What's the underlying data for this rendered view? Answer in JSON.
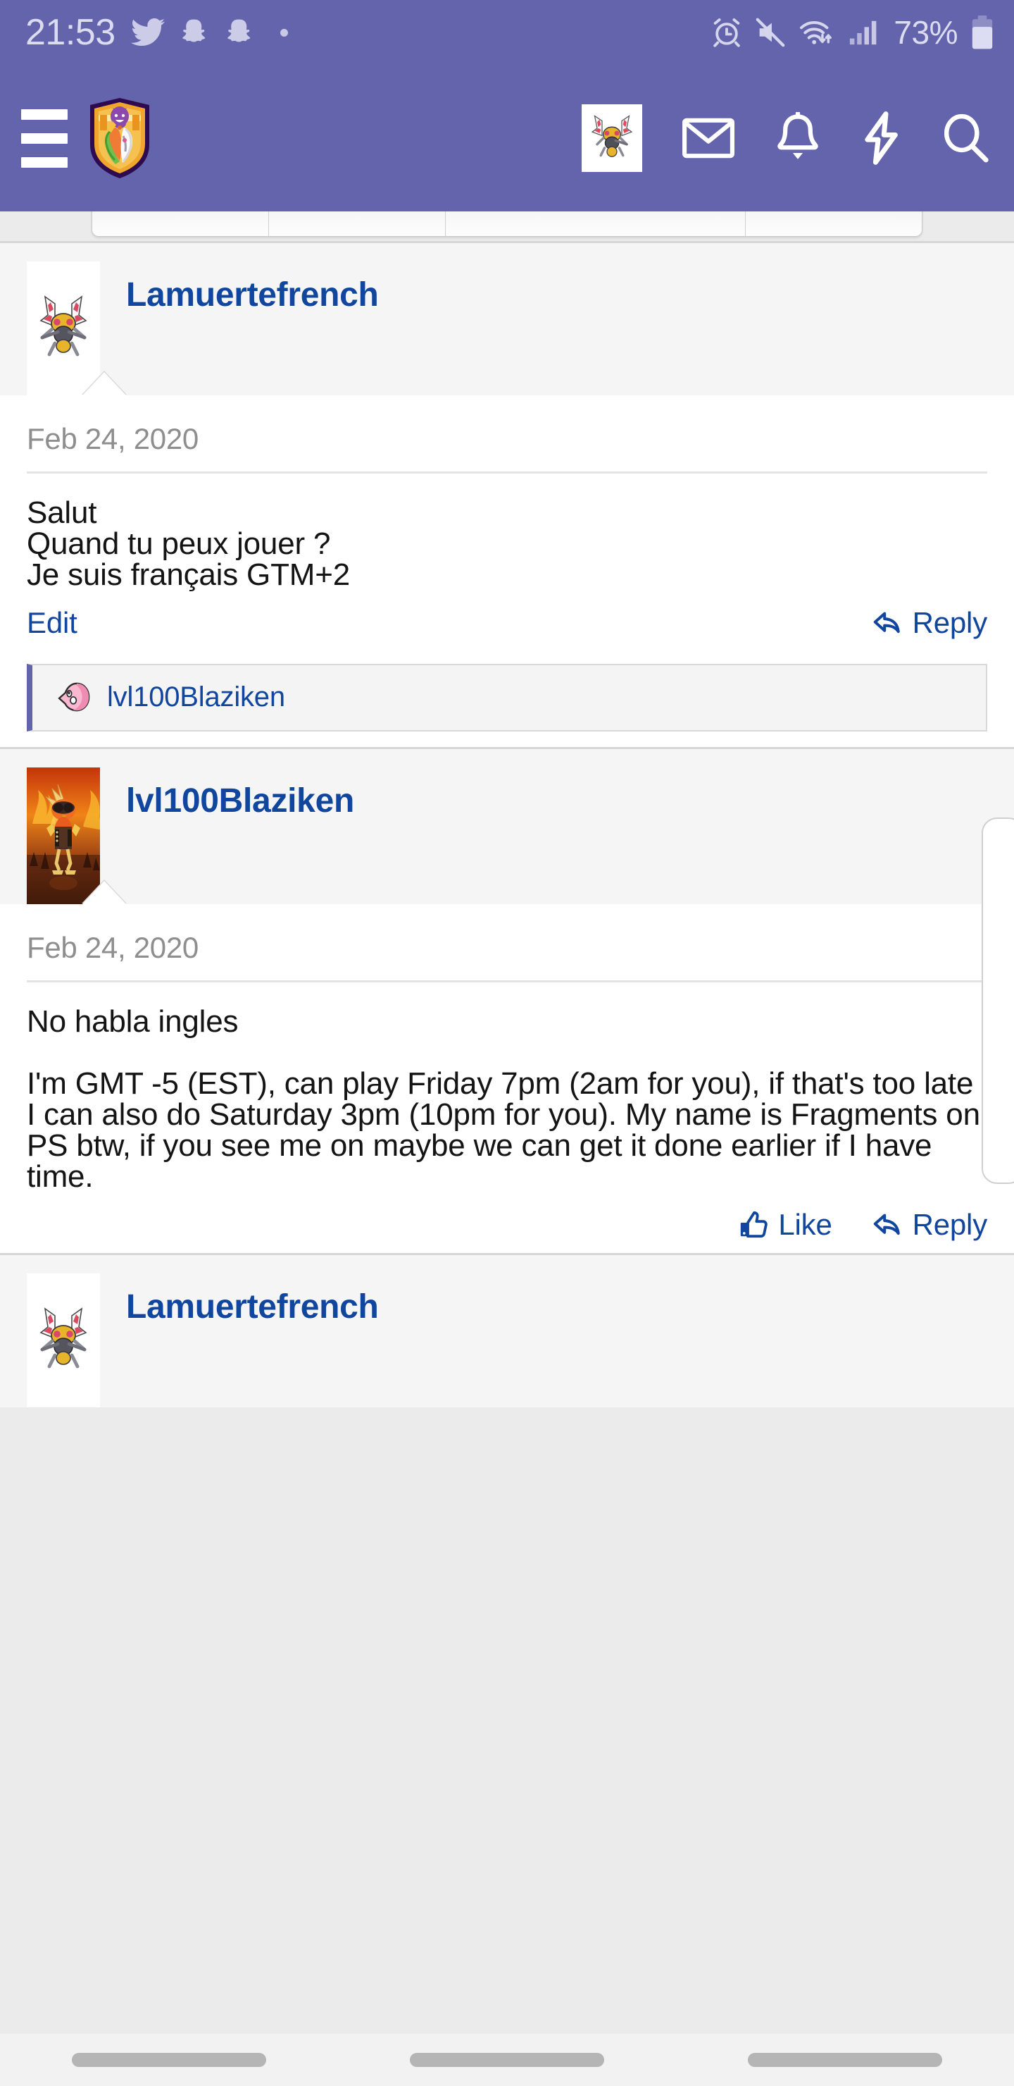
{
  "statusbar": {
    "time": "21:53",
    "battery_percent": "73%",
    "icons": [
      "twitter-icon",
      "snapchat-icon",
      "snapchat-icon",
      "dot-icon",
      "alarm-icon",
      "mute-icon",
      "wifi-icon",
      "signal-icon",
      "battery-icon"
    ]
  },
  "header": {
    "menu_icon": "hamburger-menu-icon",
    "logo": "site-logo-shield",
    "icons": [
      {
        "name": "user-avatar",
        "label": "avatar"
      },
      {
        "name": "inbox-icon",
        "label": "inbox"
      },
      {
        "name": "alerts-bell-icon",
        "label": "alerts"
      },
      {
        "name": "lightning-bolt-icon",
        "label": "whats-new"
      },
      {
        "name": "search-icon",
        "label": "search"
      }
    ],
    "accent_color": "#6464ad"
  },
  "thread": {
    "posts": [
      {
        "username": "Lamuertefrench",
        "avatar": "beedrill-sprite-avatar",
        "date": "Feb 24, 2020",
        "text": "Salut\nQuand tu peux jouer ?\nJe suis français GTM+2",
        "actions": {
          "left_label": "Edit",
          "reply_label": "Reply"
        },
        "quote": {
          "username": "lvl100Blaziken",
          "avatar": "kirby-pink-avatar"
        }
      },
      {
        "username": "lvl100Blaziken",
        "avatar": "blaziken-fire-avatar",
        "date": "Feb 24, 2020",
        "text": "No habla ingles\n\nI'm GMT -5 (EST), can play Friday 7pm (2am for you), if that's too late I can also do Saturday 3pm (10pm for you). My name is Fragments on PS btw, if you see me on maybe we can get it done earlier if I have time.",
        "actions": {
          "like_label": "Like",
          "reply_label": "Reply"
        }
      },
      {
        "username": "Lamuertefrench",
        "avatar": "beedrill-sprite-avatar"
      }
    ]
  },
  "navbar": {
    "items": [
      "recents-button",
      "home-button",
      "back-button"
    ]
  },
  "colors": {
    "header_purple": "#6464ad",
    "link_blue": "#11469e",
    "page_grey": "#ebebeb",
    "post_grey": "#f5f5f5"
  }
}
